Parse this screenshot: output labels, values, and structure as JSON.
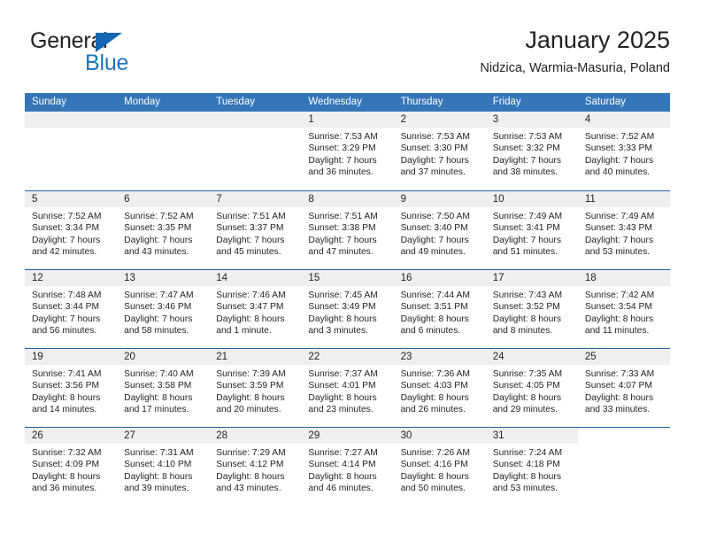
{
  "brand": {
    "name_part1": "General",
    "name_part2": "Blue",
    "color_dark": "#231f20",
    "color_blue": "#1b75bc"
  },
  "header": {
    "title": "January 2025",
    "subtitle": "Nidzica, Warmia-Masuria, Poland"
  },
  "theme": {
    "header_bg": "#3576b9",
    "week_divider": "#1f5fa8",
    "daynum_bg": "#efefef"
  },
  "weekdays": [
    "Sunday",
    "Monday",
    "Tuesday",
    "Wednesday",
    "Thursday",
    "Friday",
    "Saturday"
  ],
  "weeks": [
    [
      {
        "day": "",
        "empty": true
      },
      {
        "day": "",
        "empty": true
      },
      {
        "day": "",
        "empty": true
      },
      {
        "day": "1",
        "sunrise": "Sunrise: 7:53 AM",
        "sunset": "Sunset: 3:29 PM",
        "daylight": "Daylight: 7 hours and 36 minutes."
      },
      {
        "day": "2",
        "sunrise": "Sunrise: 7:53 AM",
        "sunset": "Sunset: 3:30 PM",
        "daylight": "Daylight: 7 hours and 37 minutes."
      },
      {
        "day": "3",
        "sunrise": "Sunrise: 7:53 AM",
        "sunset": "Sunset: 3:32 PM",
        "daylight": "Daylight: 7 hours and 38 minutes."
      },
      {
        "day": "4",
        "sunrise": "Sunrise: 7:52 AM",
        "sunset": "Sunset: 3:33 PM",
        "daylight": "Daylight: 7 hours and 40 minutes."
      }
    ],
    [
      {
        "day": "5",
        "sunrise": "Sunrise: 7:52 AM",
        "sunset": "Sunset: 3:34 PM",
        "daylight": "Daylight: 7 hours and 42 minutes."
      },
      {
        "day": "6",
        "sunrise": "Sunrise: 7:52 AM",
        "sunset": "Sunset: 3:35 PM",
        "daylight": "Daylight: 7 hours and 43 minutes."
      },
      {
        "day": "7",
        "sunrise": "Sunrise: 7:51 AM",
        "sunset": "Sunset: 3:37 PM",
        "daylight": "Daylight: 7 hours and 45 minutes."
      },
      {
        "day": "8",
        "sunrise": "Sunrise: 7:51 AM",
        "sunset": "Sunset: 3:38 PM",
        "daylight": "Daylight: 7 hours and 47 minutes."
      },
      {
        "day": "9",
        "sunrise": "Sunrise: 7:50 AM",
        "sunset": "Sunset: 3:40 PM",
        "daylight": "Daylight: 7 hours and 49 minutes."
      },
      {
        "day": "10",
        "sunrise": "Sunrise: 7:49 AM",
        "sunset": "Sunset: 3:41 PM",
        "daylight": "Daylight: 7 hours and 51 minutes."
      },
      {
        "day": "11",
        "sunrise": "Sunrise: 7:49 AM",
        "sunset": "Sunset: 3:43 PM",
        "daylight": "Daylight: 7 hours and 53 minutes."
      }
    ],
    [
      {
        "day": "12",
        "sunrise": "Sunrise: 7:48 AM",
        "sunset": "Sunset: 3:44 PM",
        "daylight": "Daylight: 7 hours and 56 minutes."
      },
      {
        "day": "13",
        "sunrise": "Sunrise: 7:47 AM",
        "sunset": "Sunset: 3:46 PM",
        "daylight": "Daylight: 7 hours and 58 minutes."
      },
      {
        "day": "14",
        "sunrise": "Sunrise: 7:46 AM",
        "sunset": "Sunset: 3:47 PM",
        "daylight": "Daylight: 8 hours and 1 minute."
      },
      {
        "day": "15",
        "sunrise": "Sunrise: 7:45 AM",
        "sunset": "Sunset: 3:49 PM",
        "daylight": "Daylight: 8 hours and 3 minutes."
      },
      {
        "day": "16",
        "sunrise": "Sunrise: 7:44 AM",
        "sunset": "Sunset: 3:51 PM",
        "daylight": "Daylight: 8 hours and 6 minutes."
      },
      {
        "day": "17",
        "sunrise": "Sunrise: 7:43 AM",
        "sunset": "Sunset: 3:52 PM",
        "daylight": "Daylight: 8 hours and 8 minutes."
      },
      {
        "day": "18",
        "sunrise": "Sunrise: 7:42 AM",
        "sunset": "Sunset: 3:54 PM",
        "daylight": "Daylight: 8 hours and 11 minutes."
      }
    ],
    [
      {
        "day": "19",
        "sunrise": "Sunrise: 7:41 AM",
        "sunset": "Sunset: 3:56 PM",
        "daylight": "Daylight: 8 hours and 14 minutes."
      },
      {
        "day": "20",
        "sunrise": "Sunrise: 7:40 AM",
        "sunset": "Sunset: 3:58 PM",
        "daylight": "Daylight: 8 hours and 17 minutes."
      },
      {
        "day": "21",
        "sunrise": "Sunrise: 7:39 AM",
        "sunset": "Sunset: 3:59 PM",
        "daylight": "Daylight: 8 hours and 20 minutes."
      },
      {
        "day": "22",
        "sunrise": "Sunrise: 7:37 AM",
        "sunset": "Sunset: 4:01 PM",
        "daylight": "Daylight: 8 hours and 23 minutes."
      },
      {
        "day": "23",
        "sunrise": "Sunrise: 7:36 AM",
        "sunset": "Sunset: 4:03 PM",
        "daylight": "Daylight: 8 hours and 26 minutes."
      },
      {
        "day": "24",
        "sunrise": "Sunrise: 7:35 AM",
        "sunset": "Sunset: 4:05 PM",
        "daylight": "Daylight: 8 hours and 29 minutes."
      },
      {
        "day": "25",
        "sunrise": "Sunrise: 7:33 AM",
        "sunset": "Sunset: 4:07 PM",
        "daylight": "Daylight: 8 hours and 33 minutes."
      }
    ],
    [
      {
        "day": "26",
        "sunrise": "Sunrise: 7:32 AM",
        "sunset": "Sunset: 4:09 PM",
        "daylight": "Daylight: 8 hours and 36 minutes."
      },
      {
        "day": "27",
        "sunrise": "Sunrise: 7:31 AM",
        "sunset": "Sunset: 4:10 PM",
        "daylight": "Daylight: 8 hours and 39 minutes."
      },
      {
        "day": "28",
        "sunrise": "Sunrise: 7:29 AM",
        "sunset": "Sunset: 4:12 PM",
        "daylight": "Daylight: 8 hours and 43 minutes."
      },
      {
        "day": "29",
        "sunrise": "Sunrise: 7:27 AM",
        "sunset": "Sunset: 4:14 PM",
        "daylight": "Daylight: 8 hours and 46 minutes."
      },
      {
        "day": "30",
        "sunrise": "Sunrise: 7:26 AM",
        "sunset": "Sunset: 4:16 PM",
        "daylight": "Daylight: 8 hours and 50 minutes."
      },
      {
        "day": "31",
        "sunrise": "Sunrise: 7:24 AM",
        "sunset": "Sunset: 4:18 PM",
        "daylight": "Daylight: 8 hours and 53 minutes."
      },
      {
        "day": "",
        "empty": true,
        "blank_tail": true
      }
    ]
  ]
}
